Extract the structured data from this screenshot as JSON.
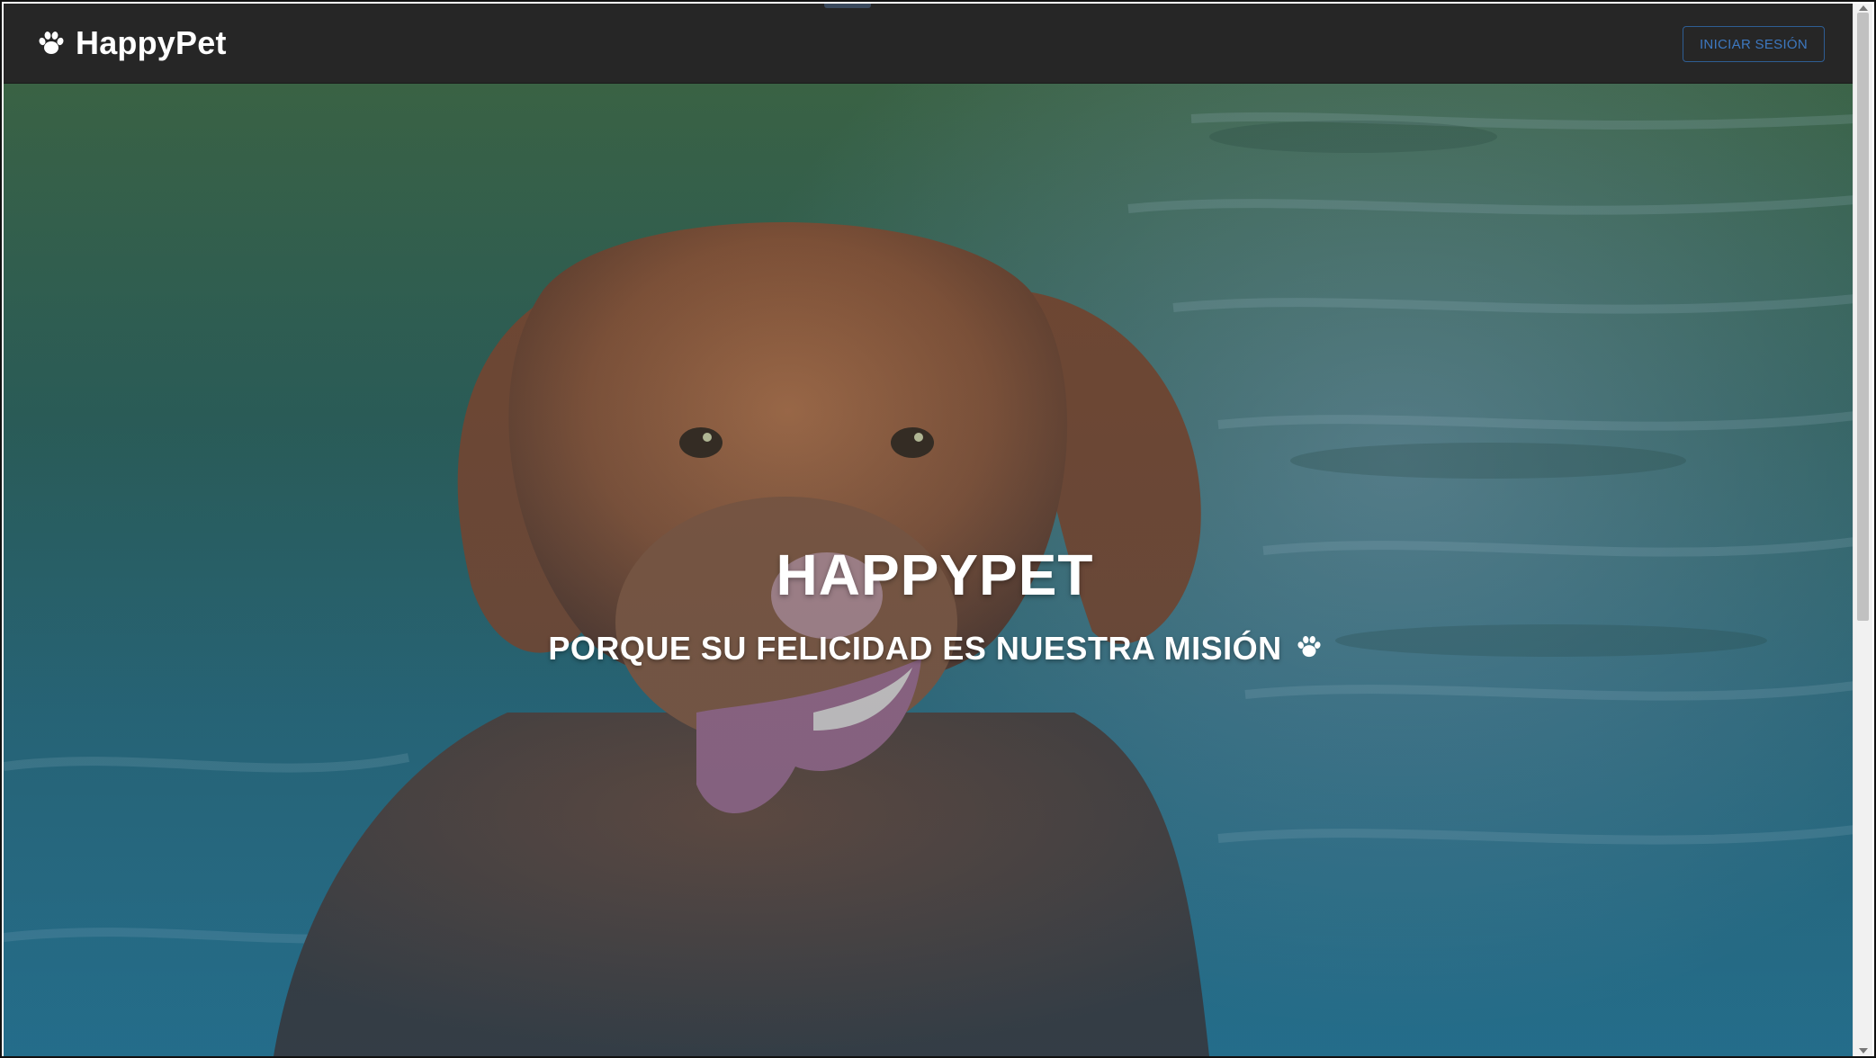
{
  "navbar": {
    "brand_icon": "paw-icon",
    "brand_name": "HappyPet",
    "login_button": "INICIAR SESIÓN"
  },
  "hero": {
    "title": "HAPPYPET",
    "subtitle": "PORQUE SU FELICIDAD ES NUESTRA MISIÓN",
    "subtitle_icon": "paw-icon",
    "background_image": "dog-photo"
  },
  "colors": {
    "navbar_bg": "#262626",
    "login_button_border": "#2e5d93",
    "login_button_text": "#3d78c0",
    "hero_text": "#ffffff"
  }
}
